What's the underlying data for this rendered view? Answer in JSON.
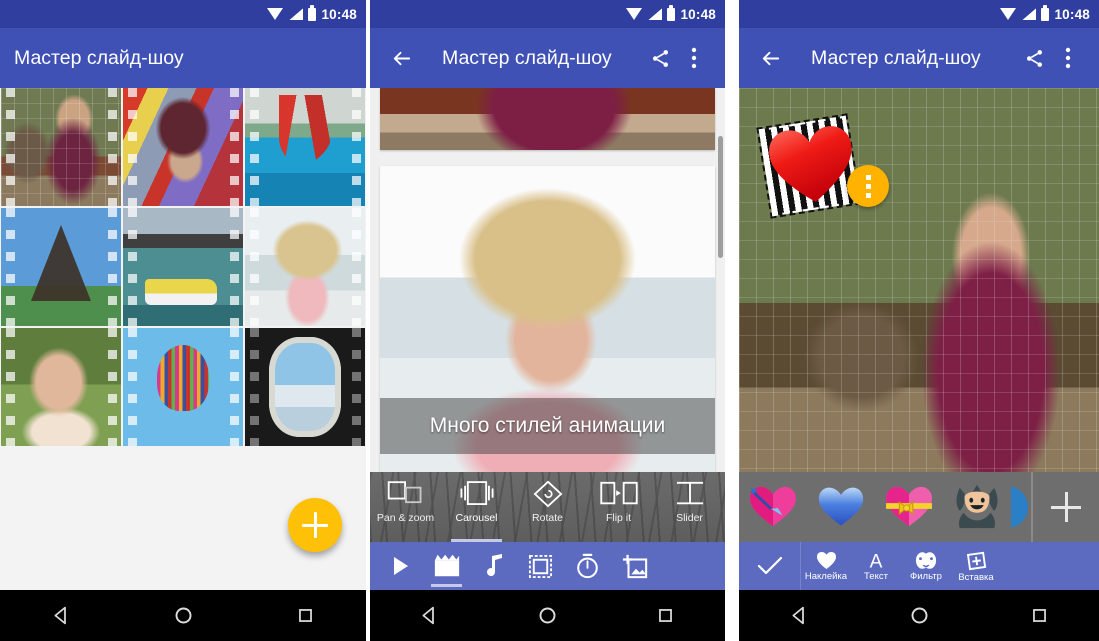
{
  "status": {
    "time": "10:48",
    "wifi_icon": "wifi-icon",
    "signal_icon": "signal-icon",
    "battery_icon": "battery-icon"
  },
  "app": {
    "title": "Мастер слайд-шоу",
    "back_icon": "back-arrow-icon",
    "share_icon": "share-icon",
    "overflow_icon": "overflow-menu-icon"
  },
  "panel1": {
    "title": "Мастер слайд-шоу",
    "fab_label": "+",
    "fab_color": "#ffc107",
    "photos": [
      {
        "name": "photo-girl-bear-zoo"
      },
      {
        "name": "photo-girl-helmet-ride"
      },
      {
        "name": "photo-waterslide-pool"
      },
      {
        "name": "photo-eiffel-tower"
      },
      {
        "name": "photo-pedal-boat-lake"
      },
      {
        "name": "photo-girl-straw-hat-sea"
      },
      {
        "name": "photo-girl-selfie-garden"
      },
      {
        "name": "photo-hot-air-balloon"
      },
      {
        "name": "photo-airplane-window"
      }
    ]
  },
  "panel2": {
    "title": "Мастер слайд-шоу",
    "caption": "Много стилей анимации",
    "transitions": [
      {
        "label": "Pan & zoom",
        "icon": "pan-zoom-icon",
        "selected": false
      },
      {
        "label": "Carousel",
        "icon": "carousel-icon",
        "selected": true
      },
      {
        "label": "Rotate",
        "icon": "rotate-icon",
        "selected": false
      },
      {
        "label": "Flip it",
        "icon": "flip-icon",
        "selected": false
      },
      {
        "label": "Slider",
        "icon": "slider-icon",
        "selected": false
      }
    ],
    "tools": [
      {
        "name": "play-icon",
        "selected": false
      },
      {
        "name": "clapperboard-icon",
        "selected": true
      },
      {
        "name": "music-note-icon",
        "selected": false
      },
      {
        "name": "frame-icon",
        "selected": false
      },
      {
        "name": "timer-icon",
        "selected": false
      },
      {
        "name": "add-photo-icon",
        "selected": false
      }
    ]
  },
  "panel3": {
    "title": "Мастер слайд-шоу",
    "selected_sticker": "red-heart-sticker",
    "sticker_menu_icon": "vertical-dots-icon",
    "stickers": [
      {
        "name": "heart-with-arrow-sticker"
      },
      {
        "name": "blue-heart-sticker"
      },
      {
        "name": "pink-heart-with-bow-sticker"
      },
      {
        "name": "jester-face-sticker"
      },
      {
        "name": "blue-circle-sticker-partial"
      }
    ],
    "add_sticker_label": "+",
    "edit_tools": [
      {
        "label": "Наклейка",
        "icon": "heart-icon"
      },
      {
        "label": "Текст",
        "icon": "text-a-icon"
      },
      {
        "label": "Фильтр",
        "icon": "filter-masks-icon"
      },
      {
        "label": "Вставка",
        "icon": "insert-plus-icon"
      }
    ],
    "confirm_icon": "checkmark-icon"
  },
  "navbar": {
    "back_icon": "nav-back-triangle-icon",
    "home_icon": "nav-home-circle-icon",
    "recents_icon": "nav-recents-square-icon"
  },
  "colors": {
    "primary": "#3f51b5",
    "primary_dark": "#303f9f",
    "toolbar": "#5c6bc0",
    "accent": "#ffc107",
    "sticker_bar": "#6e6e6e"
  }
}
